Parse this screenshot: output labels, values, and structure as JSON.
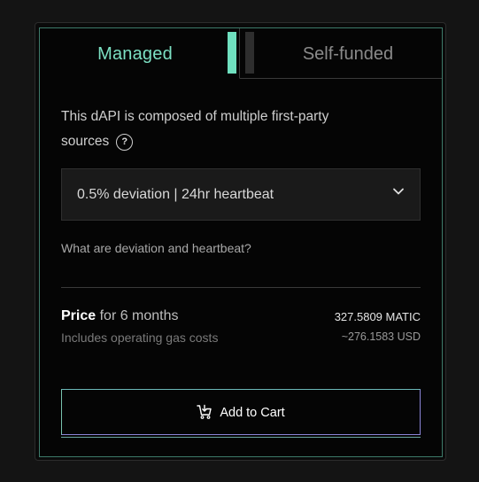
{
  "tabs": [
    {
      "label": "Managed",
      "active": true
    },
    {
      "label": "Self-funded",
      "active": false
    }
  ],
  "description": "This dAPI is composed of multiple first-party sources",
  "select": {
    "value": "0.5% deviation | 24hr heartbeat"
  },
  "link": "What are deviation and heartbeat?",
  "price": {
    "label": "Price",
    "period": "for 6 months",
    "note": "Includes operating gas costs",
    "matic": "327.5809 MATIC",
    "usd": "~276.1583 USD"
  },
  "cart_button": {
    "label": "Add to Cart"
  },
  "colors": {
    "accent": "#6fe0bf",
    "button_border": "#8b85d8"
  },
  "icons": {
    "help": "question-circle-icon",
    "chevron": "chevron-down-icon",
    "cart": "cart-icon"
  }
}
